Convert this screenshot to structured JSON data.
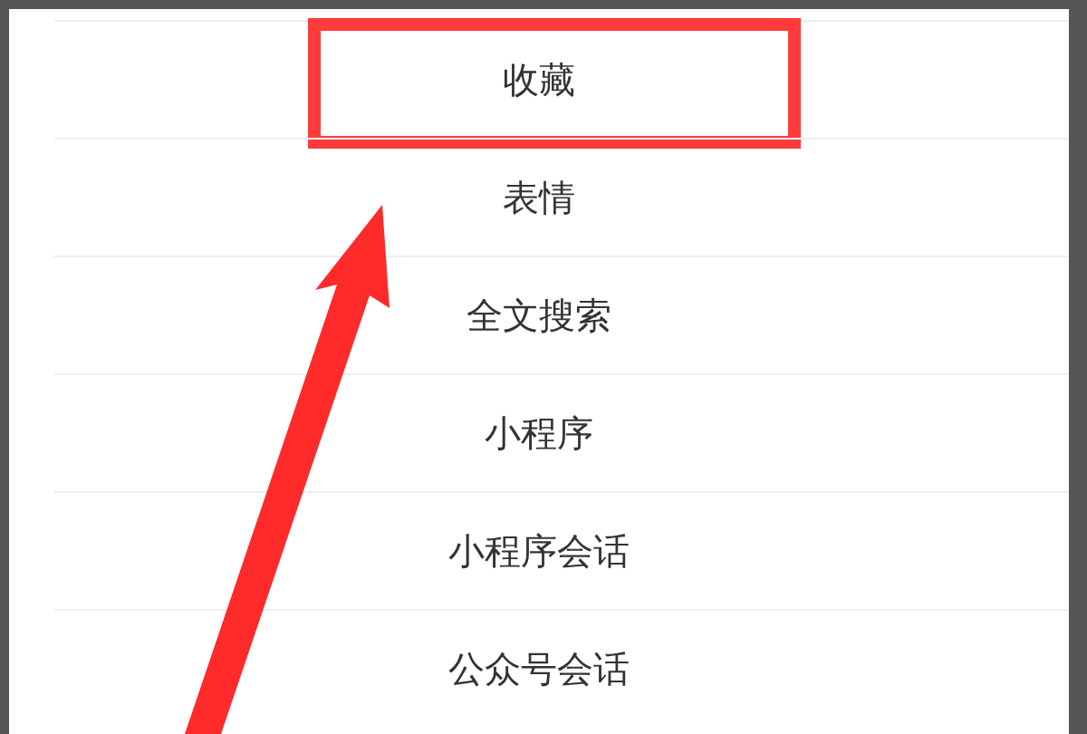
{
  "menu": {
    "items": [
      {
        "label": "收藏",
        "highlighted": true
      },
      {
        "label": "表情",
        "highlighted": false
      },
      {
        "label": "全文搜索",
        "highlighted": false
      },
      {
        "label": "小程序",
        "highlighted": false
      },
      {
        "label": "小程序会话",
        "highlighted": false
      },
      {
        "label": "公众号会话",
        "highlighted": false
      }
    ]
  }
}
